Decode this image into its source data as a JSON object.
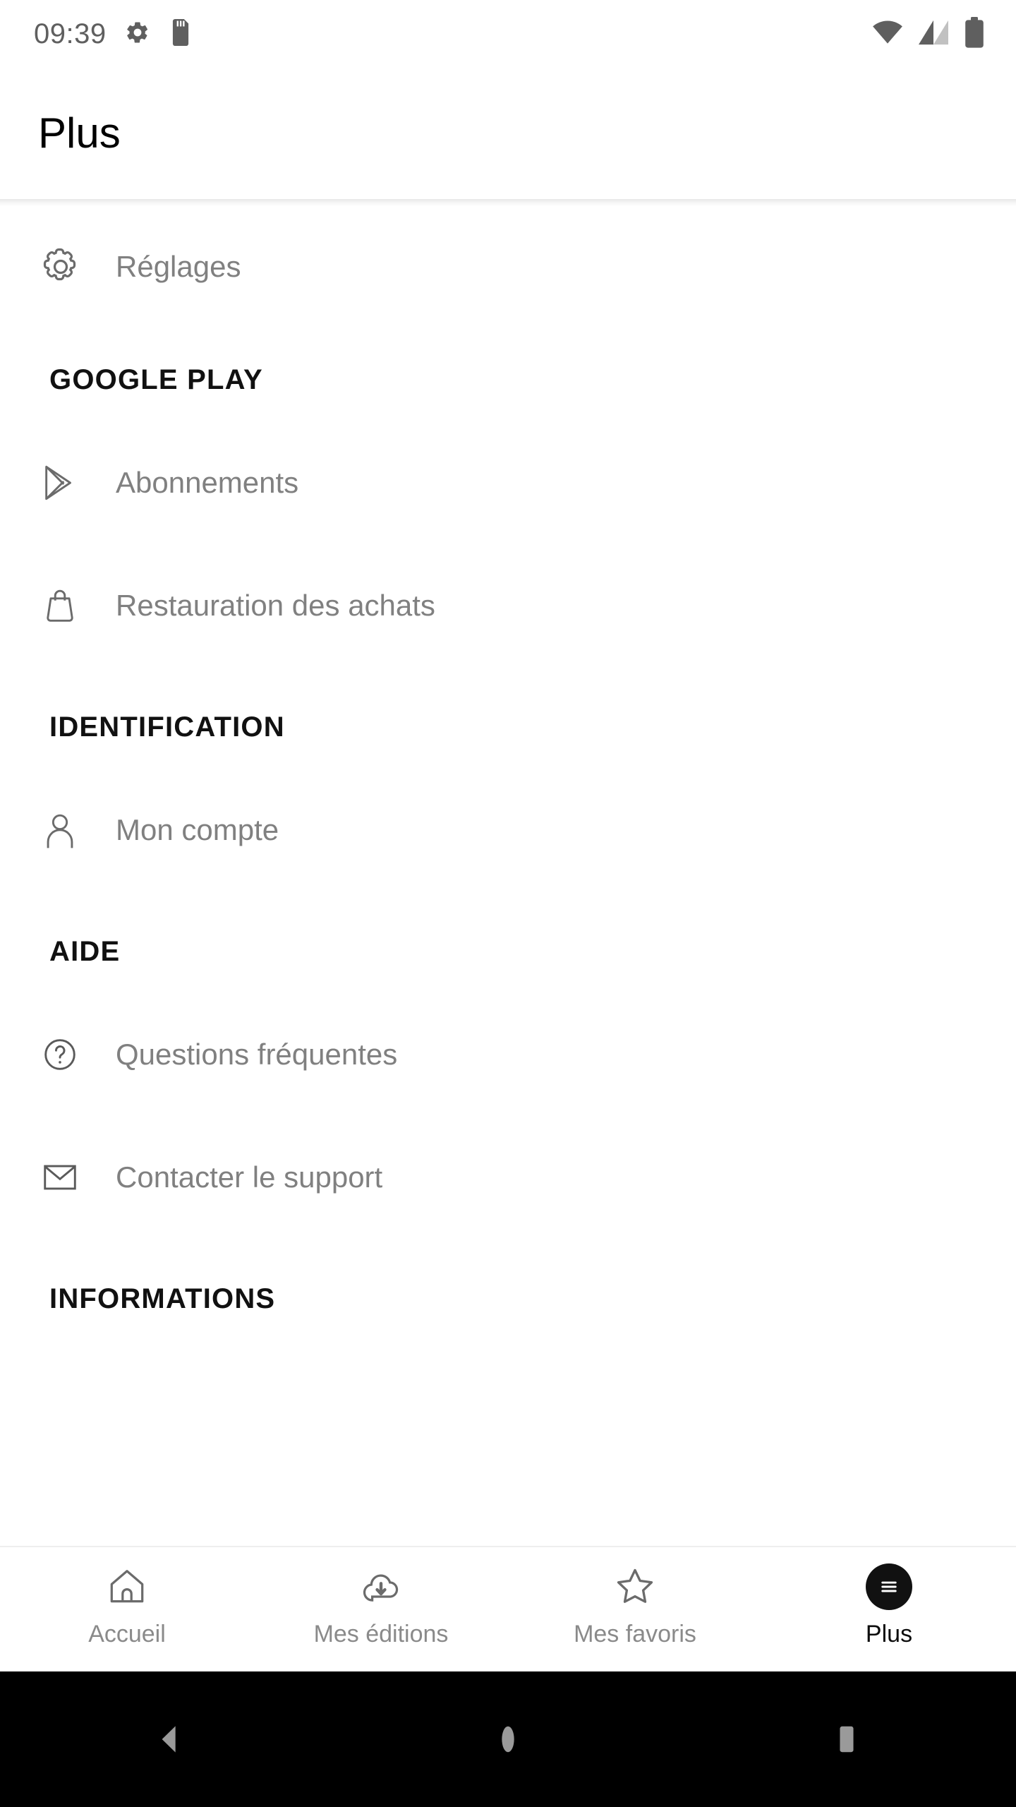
{
  "statusbar": {
    "time": "09:39",
    "left_icons": [
      "settings-gear-icon",
      "sd-card-icon"
    ],
    "right_icons": [
      "wifi-icon",
      "cellular-signal-icon",
      "battery-full-icon"
    ]
  },
  "header": {
    "title": "Plus"
  },
  "menu": {
    "top_items": [
      {
        "label": "Réglages",
        "icon": "gear-icon"
      }
    ],
    "sections": [
      {
        "title": "GOOGLE PLAY",
        "items": [
          {
            "label": "Abonnements",
            "icon": "google-play-icon"
          },
          {
            "label": "Restauration des achats",
            "icon": "shopping-bag-icon"
          }
        ]
      },
      {
        "title": "IDENTIFICATION",
        "items": [
          {
            "label": "Mon compte",
            "icon": "person-icon"
          }
        ]
      },
      {
        "title": "AIDE",
        "items": [
          {
            "label": "Questions fréquentes",
            "icon": "help-circle-icon"
          },
          {
            "label": "Contacter le support",
            "icon": "envelope-icon"
          }
        ]
      },
      {
        "title": "INFORMATIONS",
        "items": []
      }
    ]
  },
  "tabbar": {
    "tabs": [
      {
        "label": "Accueil",
        "icon": "home-icon",
        "active": false
      },
      {
        "label": "Mes éditions",
        "icon": "cloud-download-icon",
        "active": false
      },
      {
        "label": "Mes favoris",
        "icon": "star-icon",
        "active": false
      },
      {
        "label": "Plus",
        "icon": "hamburger-menu-icon",
        "active": true
      }
    ]
  },
  "sysnav": {
    "buttons": [
      "back-button",
      "home-button",
      "recents-button"
    ]
  },
  "colors": {
    "accent": "#111111",
    "label_gray": "#808080",
    "section_black": "#111111",
    "icon_gray": "#6b6b6b",
    "background": "#ffffff"
  }
}
